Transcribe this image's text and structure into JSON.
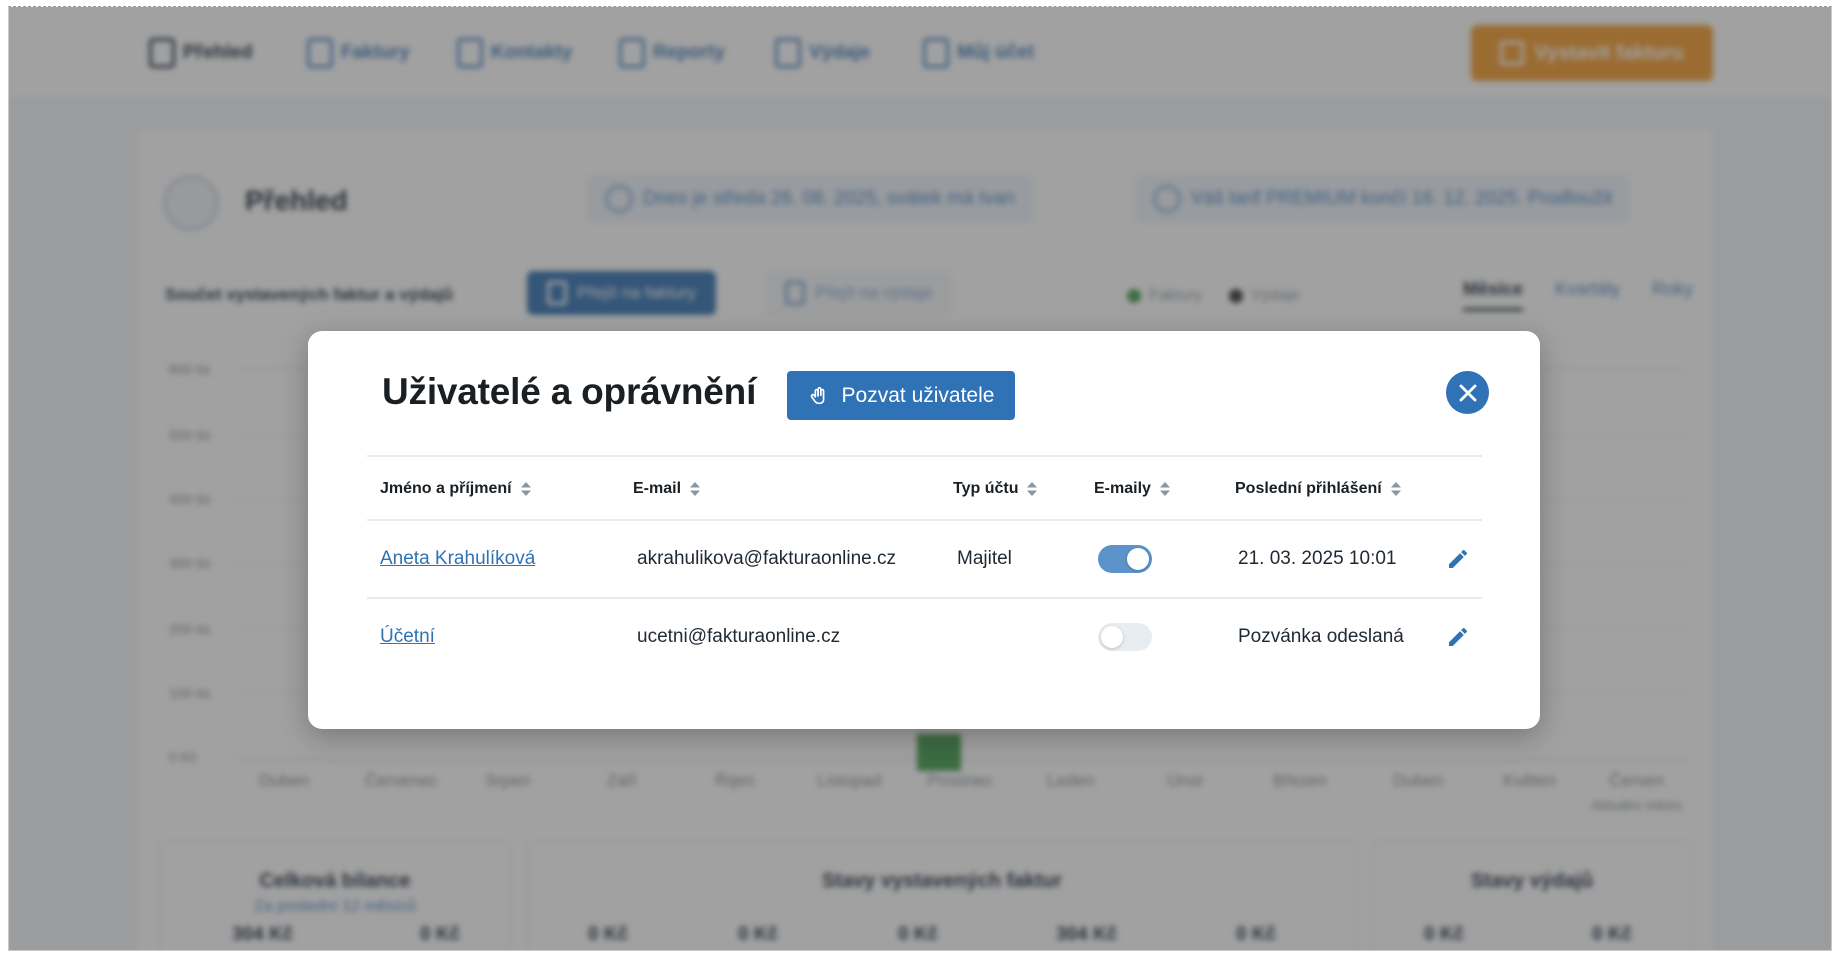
{
  "background": {
    "nav": {
      "items": [
        {
          "label": "Přehled",
          "icon": "dashboard-icon",
          "active": true
        },
        {
          "label": "Faktury",
          "icon": "invoice-icon"
        },
        {
          "label": "Kontakty",
          "icon": "contacts-icon"
        },
        {
          "label": "Reporty",
          "icon": "reports-icon"
        },
        {
          "label": "Výdaje",
          "icon": "expenses-icon"
        },
        {
          "label": "Můj účet",
          "icon": "account-icon"
        }
      ],
      "cta_label": "Vystavit fakturu"
    },
    "page_title": "Přehled",
    "notice_trial": "Dnes je středa 26. 08. 2025, svátek má Ivan",
    "notice_tariff": "Váš tarif PREMIUM končí 16. 12. 2025. Prodloužit",
    "chart_subtitle": "Součet vystavených faktur a výdajů",
    "switch_invoices": "Přejít na faktury",
    "switch_expenses": "Přejít na výdaje",
    "legend": [
      "Faktury",
      "Výdaje"
    ],
    "periods": [
      "Měsíce",
      "Kvartály",
      "Roky"
    ],
    "y_ticks": [
      "600 tis",
      "500 tis",
      "400 tis",
      "300 tis",
      "200 tis",
      "100 tis",
      "0 Kč"
    ],
    "months": [
      "Duben",
      "Červenec",
      "Srpen",
      "Září",
      "Říjen",
      "Listopad",
      "Prosinec",
      "Leden",
      "Únor",
      "Březen",
      "Duben",
      "Květen",
      "Červen"
    ],
    "months_note": "Aktuální měsíc",
    "cards": [
      {
        "title": "Celková bilance",
        "link": "Za poslední 12 měsíců",
        "values": [
          "304 Kč",
          "0 Kč"
        ]
      },
      {
        "title": "Stavy vystavených faktur",
        "values": [
          "0 Kč",
          "0 Kč",
          "0 Kč",
          "304 Kč",
          "0 Kč"
        ]
      },
      {
        "title": "Stavy výdajů",
        "values": [
          "0 Kč",
          "0 Kč"
        ]
      }
    ],
    "colors": {
      "invoices": "#3f9a4a",
      "expenses": "#333333",
      "cta": "#f39a2b",
      "primary": "#2f6fb1"
    }
  },
  "modal": {
    "title": "Uživatelé a oprávnění",
    "invite_label": "Pozvat uživatele",
    "invite_icon": "hand-icon",
    "close_icon": "close-icon",
    "columns": [
      "Jméno a příjmení",
      "E-mail",
      "Typ účtu",
      "E-maily",
      "Poslední přihlášení"
    ],
    "rows": [
      {
        "name": "Aneta Krahulíková",
        "email": "akrahulikova@fakturaonline.cz",
        "account_type": "Majitel",
        "emails_enabled": true,
        "last_login": "21. 03. 2025 10:01"
      },
      {
        "name": "Účetní",
        "email": "ucetni@fakturaonline.cz",
        "account_type": "",
        "emails_enabled": false,
        "last_login": "Pozvánka odeslaná"
      }
    ],
    "colors": {
      "primary": "#2f72b5",
      "toggle_on": "#5b93ca",
      "toggle_off": "#e8edf2"
    }
  }
}
